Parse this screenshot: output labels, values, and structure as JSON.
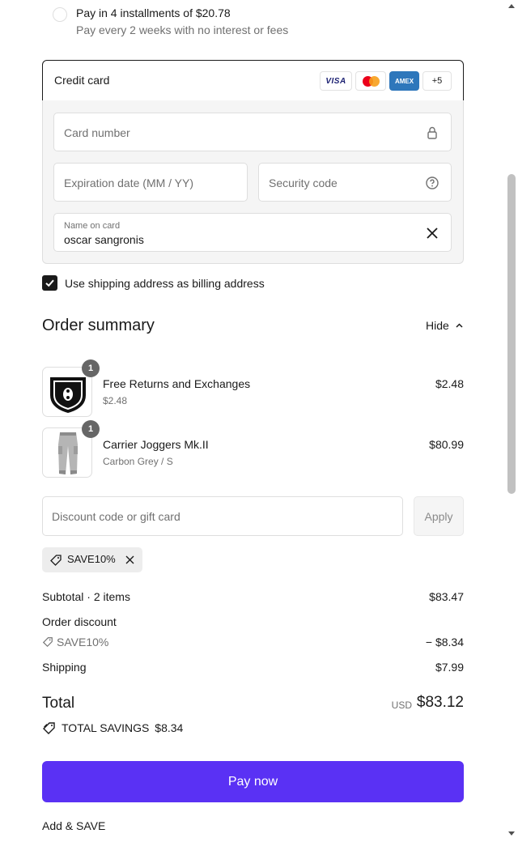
{
  "installments": {
    "title": "Pay in 4 installments of $20.78",
    "subtitle": "Pay every 2 weeks with no interest or fees"
  },
  "payment": {
    "method_title": "Credit card",
    "brands": [
      "VISA",
      "Mastercard",
      "AMEX"
    ],
    "brands_more": "+5",
    "card_number_placeholder": "Card number",
    "expiration_placeholder": "Expiration date (MM / YY)",
    "security_placeholder": "Security code",
    "name_label": "Name on card",
    "name_value": "oscar sangronis"
  },
  "billing": {
    "checkbox_label": "Use shipping address as billing address",
    "checked": true
  },
  "summary": {
    "title": "Order summary",
    "toggle_label": "Hide",
    "items": [
      {
        "name": "Free Returns and Exchanges",
        "variant": "$2.48",
        "price": "$2.48",
        "qty": "1"
      },
      {
        "name": "Carrier Joggers Mk.II",
        "variant": "Carbon Grey / S",
        "price": "$80.99",
        "qty": "1"
      }
    ],
    "discount_placeholder": "Discount code or gift card",
    "apply_label": "Apply",
    "applied_code": "SAVE10%",
    "subtotal_label": "Subtotal · 2 items",
    "subtotal_value": "$83.47",
    "order_discount_label": "Order discount",
    "order_discount_code": "SAVE10%",
    "order_discount_value": "− $8.34",
    "shipping_label": "Shipping",
    "shipping_value": "$7.99",
    "total_label": "Total",
    "total_currency": "USD",
    "total_value": "$83.12",
    "savings_label": "TOTAL SAVINGS",
    "savings_value": "$8.34"
  },
  "pay_button": "Pay now",
  "add_save_label": "Add & SAVE",
  "colors": {
    "accent": "#5a31f4",
    "border": "#dedede",
    "muted": "#707070"
  }
}
